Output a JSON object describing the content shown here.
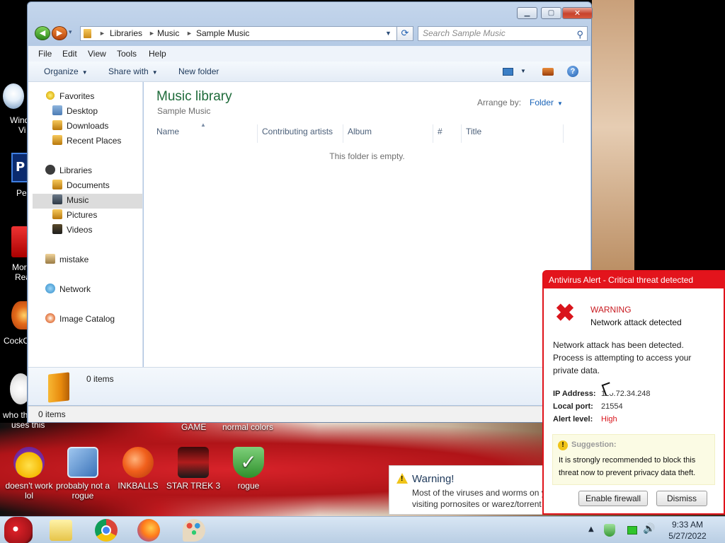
{
  "explorer": {
    "address": {
      "segments": [
        "Libraries",
        "Music",
        "Sample Music"
      ],
      "separator": "►"
    },
    "search_placeholder": "Search Sample Music",
    "menu": [
      "File",
      "Edit",
      "View",
      "Tools",
      "Help"
    ],
    "commands": {
      "organize": "Organize",
      "share_with": "Share with",
      "new_folder": "New folder"
    },
    "nav": {
      "favorites": "Favorites",
      "favorites_items": [
        "Desktop",
        "Downloads",
        "Recent Places"
      ],
      "libraries": "Libraries",
      "libraries_items": [
        "Documents",
        "Music",
        "Pictures",
        "Videos"
      ],
      "user": "mistake",
      "network": "Network",
      "image_catalog": "Image Catalog"
    },
    "library_title": "Music library",
    "library_subtitle": "Sample Music",
    "arrange_label": "Arrange by:",
    "arrange_value": "Folder",
    "columns": [
      "Name",
      "Contributing artists",
      "Album",
      "#",
      "Title"
    ],
    "empty_message": "This folder is empty.",
    "details_count": "0 items",
    "status_count": "0 items"
  },
  "desktop_icons": {
    "left_partial": [
      "Wind",
      "Vi",
      "Pe",
      "Mor",
      "Rea",
      "CockC",
      "who th",
      "uses this"
    ],
    "row_labels_cut": [
      "GAME",
      "normal colors"
    ],
    "bottom": [
      "doesn't work lol",
      "probably not a rogue",
      "INKBALLS",
      "STAR TREK 3",
      "rogue"
    ]
  },
  "antivirus_popup": {
    "title": "Antivirus Alert - Critical threat detected",
    "heading": "WARNING",
    "subheading": "Network attack detected",
    "body": [
      "Network attack has been detected.",
      "Process is attempting to access your",
      "private data."
    ],
    "ip_label": "IP Address:",
    "ip_value": "110.72.34.248",
    "port_label": "Local port:",
    "port_value": "21554",
    "level_label": "Alert level:",
    "level_value": "High",
    "suggestion_title": "Suggestion:",
    "suggestion_text": [
      "It is strongly recommended to block this",
      "threat now to prevent privacy data theft."
    ],
    "enable_button": "Enable firewall",
    "dismiss_button": "Dismiss",
    "accent_color": "#e3141c"
  },
  "warning_balloon": {
    "title": "Warning!",
    "lines": [
      "Most of the viruses and worms on y",
      "visiting pornosites or warez/torrent"
    ]
  },
  "taskbar": {
    "time": "9:33 AM",
    "date": "5/27/2022"
  }
}
